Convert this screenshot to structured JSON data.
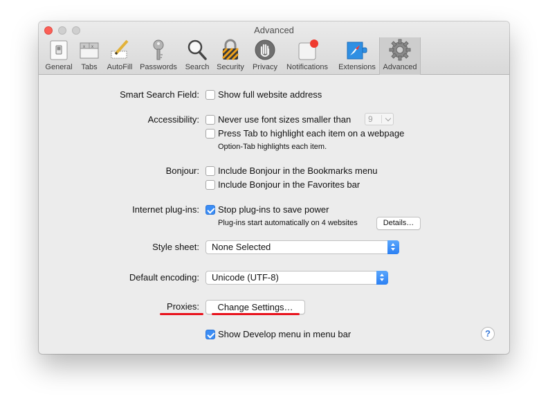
{
  "window": {
    "title": "Advanced"
  },
  "toolbar": {
    "tabs": [
      {
        "label": "General",
        "icon": "general-switch-icon"
      },
      {
        "label": "Tabs",
        "icon": "tabs-icon"
      },
      {
        "label": "AutoFill",
        "icon": "autofill-pencil-icon"
      },
      {
        "label": "Passwords",
        "icon": "key-icon"
      },
      {
        "label": "Search",
        "icon": "magnifier-icon"
      },
      {
        "label": "Security",
        "icon": "padlock-icon"
      },
      {
        "label": "Privacy",
        "icon": "hand-icon"
      },
      {
        "label": "Notifications",
        "icon": "notification-icon"
      },
      {
        "label": "Extensions",
        "icon": "puzzle-compass-icon"
      },
      {
        "label": "Advanced",
        "icon": "gear-icon",
        "selected": true
      }
    ]
  },
  "settings": {
    "smart_search": {
      "label": "Smart Search Field:",
      "option": "Show full website address",
      "checked": false
    },
    "accessibility": {
      "label": "Accessibility:",
      "font_size_option": "Never use font sizes smaller than",
      "font_size_value": "9",
      "tab_option": "Press Tab to highlight each item on a webpage",
      "tab_note": "Option-Tab highlights each item."
    },
    "bonjour": {
      "label": "Bonjour:",
      "bookmarks_option": "Include Bonjour in the Bookmarks menu",
      "favorites_option": "Include Bonjour in the Favorites bar"
    },
    "plugins": {
      "label": "Internet plug-ins:",
      "option": "Stop plug-ins to save power",
      "checked": true,
      "note": "Plug-ins start automatically on 4 websites",
      "details_button": "Details…"
    },
    "style_sheet": {
      "label": "Style sheet:",
      "value": "None Selected"
    },
    "encoding": {
      "label": "Default encoding:",
      "value": "Unicode (UTF-8)"
    },
    "proxies": {
      "label": "Proxies:",
      "button": "Change Settings…"
    },
    "develop": {
      "option": "Show Develop menu in menu bar",
      "checked": true
    },
    "help": "?"
  },
  "colors": {
    "accent": "#3b8df5",
    "annotation": "#e8101a"
  }
}
